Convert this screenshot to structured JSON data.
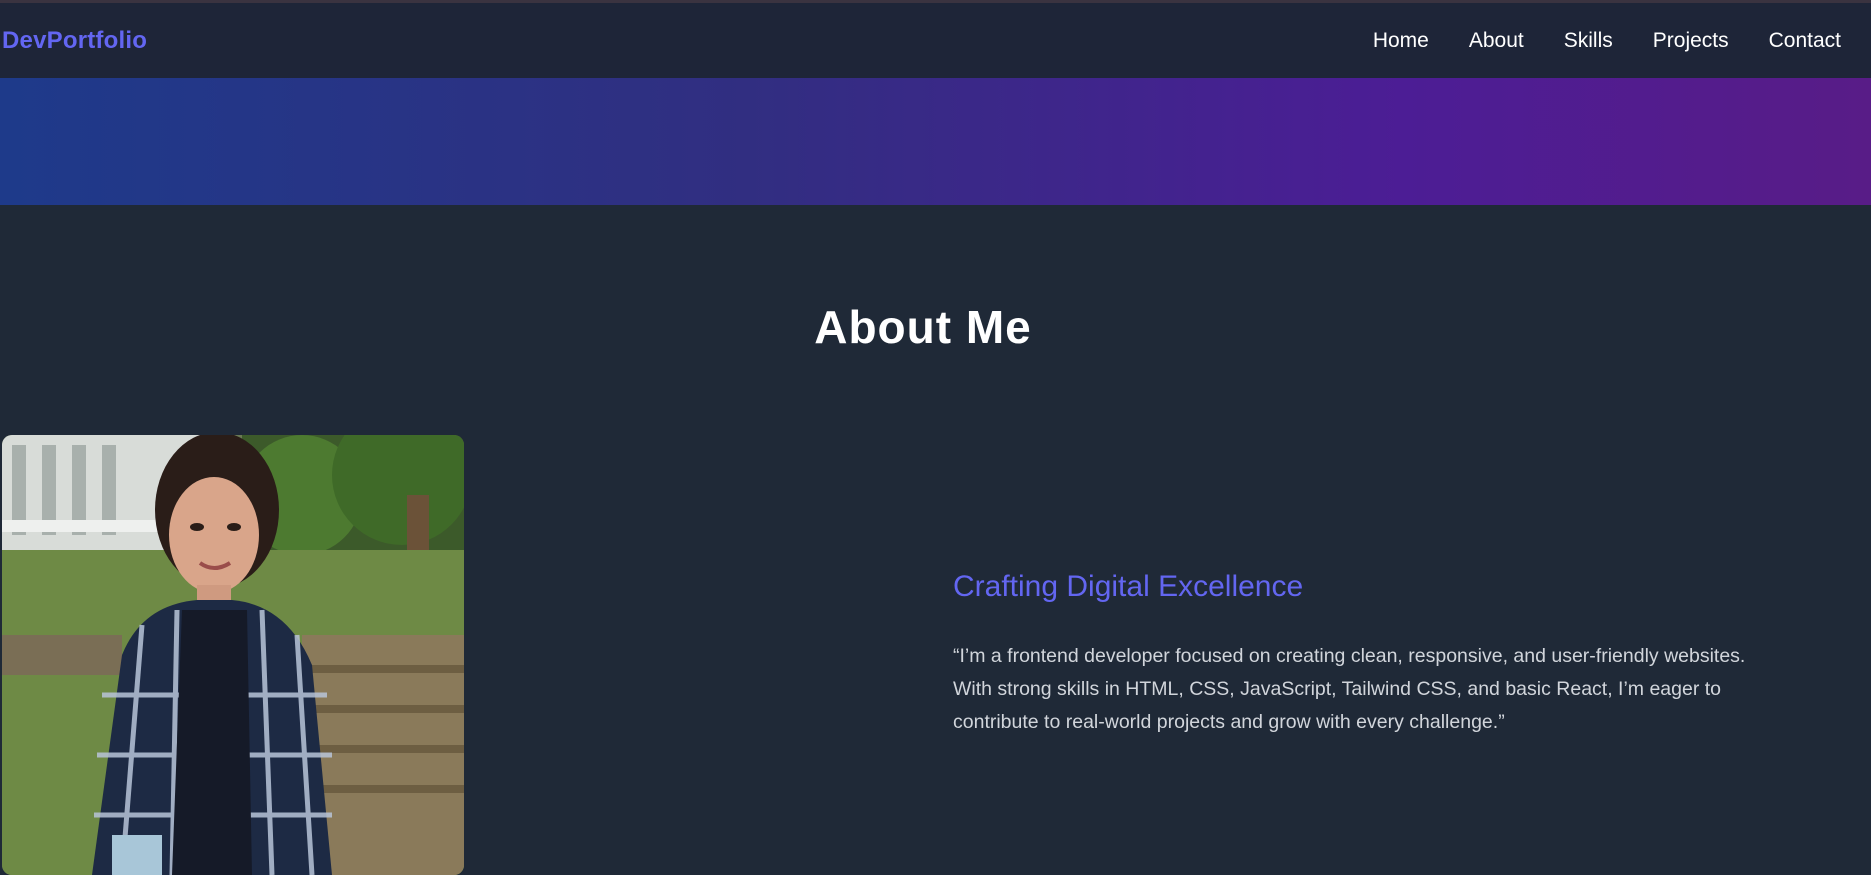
{
  "nav": {
    "brand": "DevPortfolio",
    "links": [
      "Home",
      "About",
      "Skills",
      "Projects",
      "Contact"
    ]
  },
  "about": {
    "title": "About Me",
    "tagline": "Crafting Digital Excellence",
    "bio_lines": [
      "“I’m a frontend developer focused on creating clean, responsive, and user-friendly websites.",
      "With strong skills in HTML, CSS, JavaScript, Tailwind CSS, and basic React, I’m eager to",
      "contribute to real-world projects and grow with every challenge.”"
    ]
  },
  "colors": {
    "background": "#1f2937",
    "navbar": "#1e2538",
    "accent": "#6366f1",
    "banner_start": "#1e3a8a",
    "banner_end": "#581c87"
  }
}
